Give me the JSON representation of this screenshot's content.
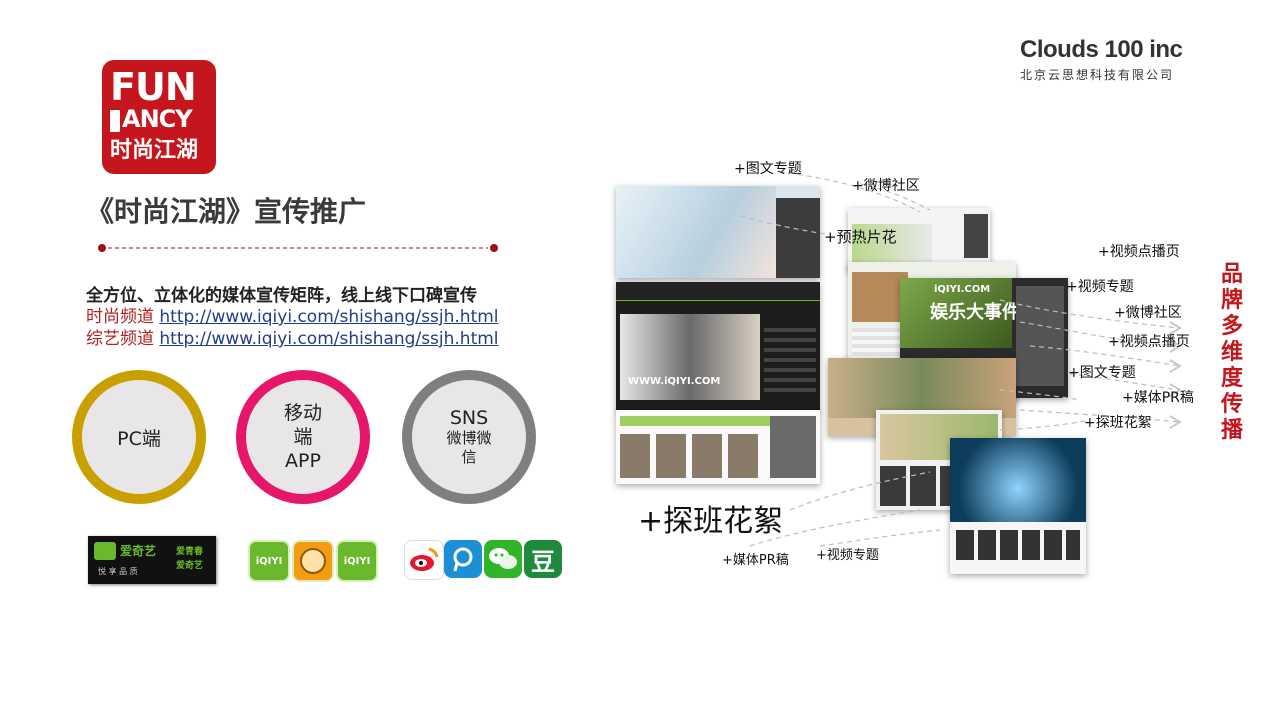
{
  "company": {
    "logo_text": "Clouds 100 inc",
    "name": "北京云思想科技有限公司"
  },
  "show_logo": {
    "line1": "FUN",
    "line2": "ANCY",
    "line3": "时尚江湖"
  },
  "title": "《时尚江湖》宣传推广",
  "subtitle": "全方位、立体化的媒体宣传矩阵，线上线下口碑宣传",
  "channels": [
    {
      "label": "时尚频道",
      "url": "http://www.iqiyi.com/shishang/ssjh.html"
    },
    {
      "label": "综艺频道",
      "url": "http://www.iqiyi.com/shishang/ssjh.html"
    }
  ],
  "platforms": [
    {
      "label": "PC端",
      "color": "#c9a000"
    },
    {
      "label": "移动\n端\nAPP",
      "color": "#e6176a"
    },
    {
      "label": "SNS",
      "sublabel": "微博微\n信",
      "color": "#7f7f7f"
    }
  ],
  "brand_logos": {
    "iqiyi": "爱奇艺",
    "iqiyi_slogan": "悦 享 品 质",
    "iqiyi_youth": "爱青春",
    "iqiyi_youth2": "爱奇艺",
    "app_icon_text": "iQIYI",
    "douban_char": "豆"
  },
  "annotations": {
    "a1": "+图文专题",
    "a2": "+微博社区",
    "a3": "+预热片花",
    "a4": "+视频点播页",
    "a5": "+视频专题",
    "a6": "+微博社区",
    "a7": "+视频点播页",
    "a8": "+图文专题",
    "a9": "+媒体PR稿",
    "a10": "+探班花絮",
    "a11": "+探班花絮",
    "a12": "+媒体PR稿",
    "a13": "+视频专题"
  },
  "brand_vertical": "品牌多维度传播",
  "screenshot_texts": {
    "iqiyi_watermark": "WWW.iQIYI.COM",
    "iqiyi_logo": "iQIYI.COM",
    "banner": "娱乐大事件"
  }
}
